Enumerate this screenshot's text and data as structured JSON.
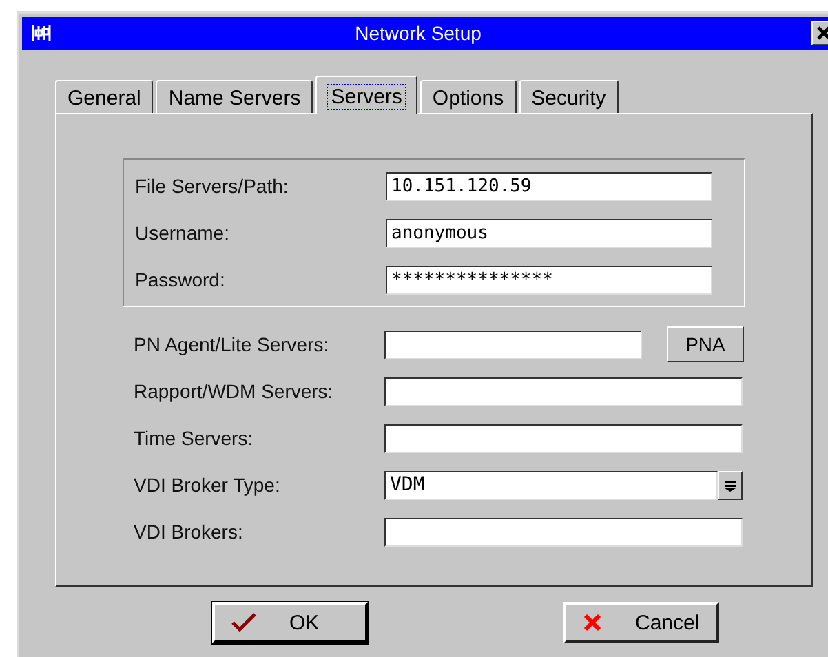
{
  "window": {
    "title": "Network Setup"
  },
  "tabs": [
    {
      "label": "General",
      "selected": false
    },
    {
      "label": "Name Servers",
      "selected": false
    },
    {
      "label": "Servers",
      "selected": true
    },
    {
      "label": "Options",
      "selected": false
    },
    {
      "label": "Security",
      "selected": false
    }
  ],
  "file_server_group": [
    {
      "label": "File Servers/Path:",
      "value": "10.151.120.59"
    },
    {
      "label": "Username:",
      "value": "anonymous"
    },
    {
      "label": "Password:",
      "value": "***************"
    }
  ],
  "server_fields": [
    {
      "kind": "text-with-button",
      "label": "PN Agent/Lite Servers:",
      "button": "PNA"
    },
    {
      "kind": "text",
      "label": "Rapport/WDM Servers:"
    },
    {
      "kind": "text",
      "label": "Time Servers:"
    },
    {
      "kind": "dropdown",
      "label": "VDI Broker Type:",
      "value": "VDM"
    },
    {
      "kind": "text",
      "label": "VDI Brokers:"
    }
  ],
  "buttons": [
    {
      "kind": "ok",
      "label": "OK"
    },
    {
      "kind": "cancel",
      "label": "Cancel"
    }
  ]
}
